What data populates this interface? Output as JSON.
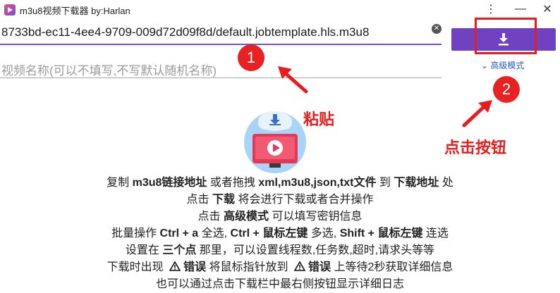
{
  "window": {
    "title": "m3u8视频下载器 by:Harlan",
    "menu_glyph": "⋮",
    "minimize_glyph": "—",
    "close_glyph": "✕"
  },
  "url_input": {
    "value": "8733bd-ec11-4ee4-9709-009d72d09f8d/default.jobtemplate.hls.m3u8",
    "clear_icon": "clear-circle-icon"
  },
  "name_input": {
    "placeholder": "视频名称(可以不填写,不写默认随机名称)",
    "value": ""
  },
  "download_button": {
    "icon": "download-icon"
  },
  "advanced": {
    "label": "高级模式",
    "icon": "chevron-down-icon"
  },
  "annotations": {
    "badge1": "1",
    "badge2": "2",
    "paste": "粘贴",
    "click": "点击按钮"
  },
  "instructions": {
    "l1": [
      "复制 ",
      "m3u8链接地址",
      " 或者拖拽 ",
      "xml,m3u8,json,txt文件",
      " 到 ",
      "下载地址",
      " 处"
    ],
    "l2": [
      "点击 ",
      "下载",
      " 将会进行下载或者合并操作"
    ],
    "l3": [
      "点击 ",
      "高级模式",
      " 可以填写密钥信息"
    ],
    "l4": [
      "批量操作 ",
      "Ctrl + a",
      " 全选, ",
      "Ctrl + 鼠标左键",
      " 多选, ",
      "Shift + 鼠标左键",
      " 连选"
    ],
    "l5": [
      "设置在 ",
      "三个点",
      " 那里，可以设置线程数,任务数,超时,请求头等等"
    ],
    "l6": [
      "下载时出现 ",
      "错误",
      " 将鼠标指针放到 ",
      "错误",
      " 上等待2秒获取详细信息"
    ],
    "l7": "也可以通过点击下载栏中最右侧按钮显示详细日志"
  },
  "colors": {
    "accent": "#6f42c1",
    "annotation_red": "#e81c1c",
    "link": "#2a57c9"
  }
}
